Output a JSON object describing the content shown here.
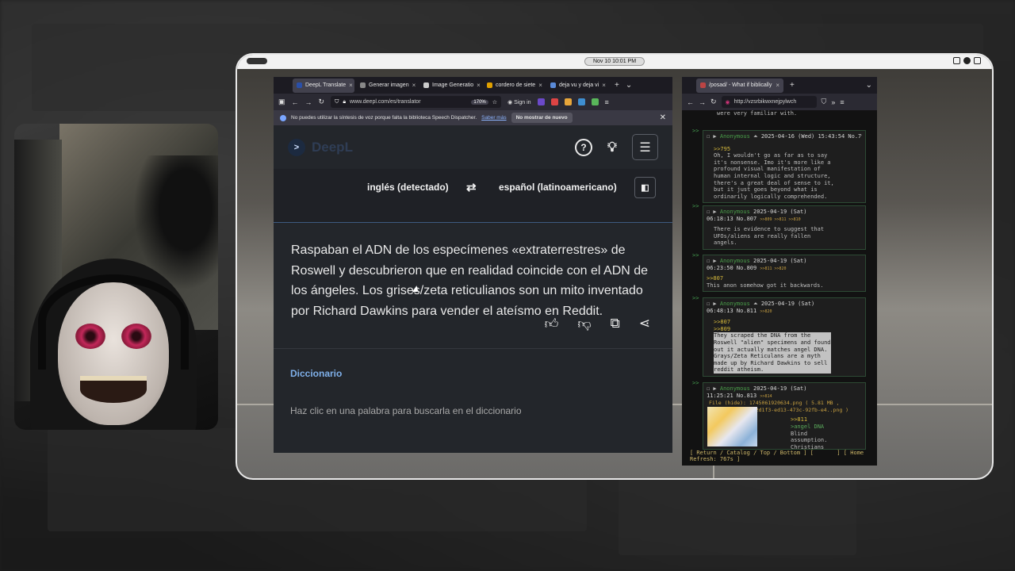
{
  "clock": "Nov 10  10:01 PM",
  "browser1": {
    "tabs": [
      {
        "label": "DeepL Translate",
        "active": true,
        "icon_color": "#2a4fa8"
      },
      {
        "label": "Generar imagen",
        "active": false,
        "icon_color": "#888888"
      },
      {
        "label": "Image Generatio",
        "active": false,
        "icon_color": "#cccccc"
      },
      {
        "label": "cordero de siete",
        "active": false,
        "icon_color": "#e0a000"
      },
      {
        "label": "deja vu y deja vi",
        "active": false,
        "icon_color": "#5a8ad8"
      }
    ],
    "url": "www.deepl.com/es/translator",
    "zoom": "170%",
    "signin": "Sign in",
    "notification": {
      "text": "No puedes utilizar la síntesis de voz porque falta la biblioteca Speech Dispatcher.",
      "link": "Saber más",
      "button": "No mostrar de nuevo"
    }
  },
  "deepl": {
    "logo": "DeepL",
    "source_lang": "inglés (detectado)",
    "target_lang": "español (latinoamericano)",
    "translation": "Raspaban el ADN de los especímenes «extraterrestres» de Roswell y descubrieron que en realidad coincide con el ADN de los ángeles. Los grises/zeta reticulianos son un mito inventado por Richard Dawkins para vender el ateísmo en Reddit.",
    "dictionary_title": "Diccionario",
    "dictionary_hint": "Haz clic en una palabra para buscarla en el diccionario"
  },
  "browser2": {
    "tab": "/posad/ - What if biblically",
    "url": "http://vzsrbikwxnejpylwch"
  },
  "thread": {
    "top_text": "were very familiar with.",
    "posts": [
      {
        "name": "Anonymous",
        "date": "2025-04-16 (Wed) 15:43:54 No.796",
        "quote": ">>795",
        "body": "Oh, I wouldn't go as far as to say\nit's nonsense. Imo it's more like a\nprofound visual manifestation of\nhuman internal logic and structure,\nthere's a great deal of sense to it,\nbut it just goes beyond what is\nordinarily logically comprehended."
      },
      {
        "name": "Anonymous",
        "date": "2025-04-19 (Sat)",
        "date2": "06:18:13 No.807",
        "backlinks": ">>809 >>811 >>810",
        "body": "There is evidence to suggest that\nUFOs/aliens are really fallen\nangels."
      },
      {
        "name": "Anonymous",
        "date": "2025-04-19 (Sat)",
        "date2": "06:23:50 No.809",
        "backlinks": ">>811 >>820",
        "quote": ">>807",
        "body": "This anon somehow got it backwards."
      },
      {
        "name": "Anonymous",
        "date": "2025-04-19 (Sat)",
        "date2": "06:48:13 No.811",
        "backlinks": ">>820",
        "quote": ">>807",
        "quote2": ">>809",
        "body": "They scraped the DNA from the\nRoswell \"alien\" specimens and found\nout it actually matches angel DNA.\nGrays/Zeta Reticulans are a myth\nmade up by Richard Dawkins to sell\nreddit atheism."
      },
      {
        "name": "Anonymous",
        "date": "2025-04-19 (Sat)",
        "date2": "11:25:21 No.813",
        "backlinks": ">>814",
        "file": "File (hide): 1745061920634.png ( 5.81 MB ,",
        "file2": "2602x3660 , d032d1f3-ed13-473c-92fb-e4..png )",
        "quote": ">>811",
        "green": ">angel DNA",
        "body": "Blind\nassumption.\nChristians"
      }
    ],
    "footer": "[ Return / Catalog / Top / Bottom ] [       ] [ Home\nRefresh: 767s ]"
  }
}
